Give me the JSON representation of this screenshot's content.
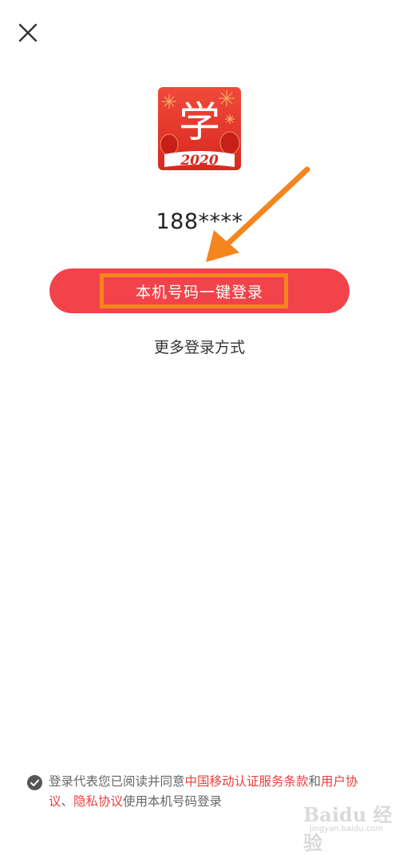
{
  "header": {
    "close_icon": "close-icon"
  },
  "app": {
    "logo_char": "学",
    "logo_year": "2020",
    "logo_colors": {
      "background": "#e8352d",
      "accent": "#f5d27a"
    }
  },
  "login": {
    "phone_number": "188****",
    "one_click_button_label": "本机号码一键登录",
    "more_options_label": "更多登录方式"
  },
  "annotation": {
    "highlight_color": "#f5851f",
    "arrow_color": "#f5851f"
  },
  "agreement": {
    "checked": true,
    "text_prefix": "登录代表您已阅读并同意",
    "link_terms": "中国移动认证服务条款",
    "text_and": "和",
    "link_user": "用户协议",
    "text_sep": "、",
    "link_privacy": "隐私协议",
    "text_suffix": "使用本机号码登录"
  },
  "watermark": {
    "brand": "Baidu 经验",
    "url": "jingyan.baidu.com"
  },
  "colors": {
    "primary_button": "#f2434a",
    "link": "#e8403f"
  }
}
